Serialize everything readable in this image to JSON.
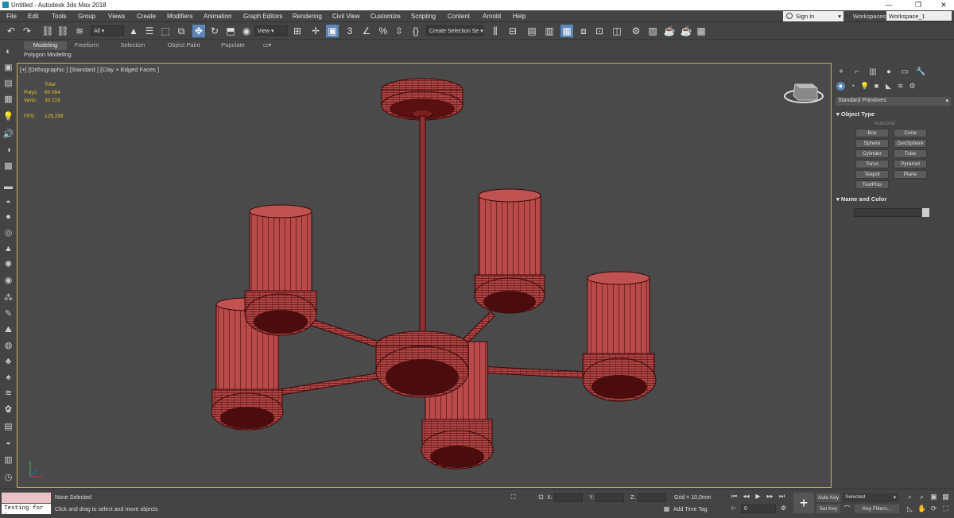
{
  "window": {
    "title": "Untitled - Autodesk 3ds Max 2018",
    "minimize": "—",
    "maximize": "❐",
    "close": "✕"
  },
  "menu": [
    "File",
    "Edit",
    "Tools",
    "Group",
    "Views",
    "Create",
    "Modifiers",
    "Animation",
    "Graph Editors",
    "Rendering",
    "Civil View",
    "Customize",
    "Scripting",
    "Content",
    "Arnold",
    "Help"
  ],
  "signin": "Sign In",
  "workspaces": {
    "label": "Workspaces:",
    "value": "Workspace_1"
  },
  "toolbar": {
    "filter": "All",
    "view": "View",
    "selection_set": "Create Selection Se"
  },
  "ribbon": {
    "tabs": [
      "Modeling",
      "Freeform",
      "Selection",
      "Object Paint",
      "Populate"
    ],
    "sub": "Polygon Modeling"
  },
  "viewport": {
    "label": "[+] [Orthographic ] [Standard ] [Clay + Edged Faces ]",
    "stats": {
      "total": "Total",
      "polys_label": "Polys:",
      "polys": "60 064",
      "verts_label": "Verts:",
      "verts": "30 216",
      "fps_label": "FPS:",
      "fps": "129,299"
    }
  },
  "command_panel": {
    "dropdown": "Standard Primitives",
    "object_type": "Object Type",
    "autogrid": "AutoGrid",
    "buttons": [
      "Box",
      "Cone",
      "Sphere",
      "GeoSphere",
      "Cylinder",
      "Tube",
      "Torus",
      "Pyramid",
      "Teapot",
      "Plane",
      "TextPlus"
    ],
    "name_and_color": "Name and Color"
  },
  "status": {
    "maxscript": "Testing for :",
    "selection": "None Selected",
    "prompt": "Click and drag to select and move objects",
    "x": "X:",
    "y": "Y:",
    "z": "Z:",
    "grid": "Grid = 10,0mm",
    "add_time_tag": "Add Time Tag",
    "frame": "0",
    "auto_key": "Auto Key",
    "set_key": "Set Key",
    "selected": "Selected",
    "key_filters": "Key Filters..."
  },
  "colors": {
    "wire_fill": "#b94a4a",
    "wire_line": "#3a0808",
    "shadow": "#4a0c0c",
    "viewport_border": "#c9b25a",
    "stats": "#e6c12a"
  }
}
